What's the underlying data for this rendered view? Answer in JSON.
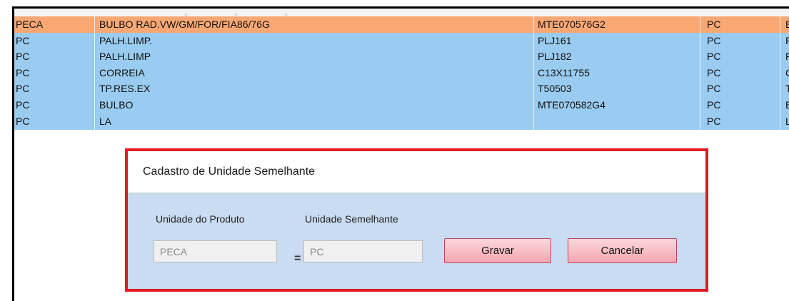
{
  "table": {
    "rows": [
      {
        "unit": "PECA",
        "description": "BULBO RAD.VW/GM/FOR/FIA86/76G",
        "code": "MTE070576G2",
        "similar": "PC",
        "next": "B",
        "selected": true
      },
      {
        "unit": "PC",
        "description": "PALH.LIMP.",
        "code": "PLJ161",
        "similar": "PC",
        "next": "F",
        "selected": false
      },
      {
        "unit": "PC",
        "description": "PALH.LIMP",
        "code": "PLJ182",
        "similar": "PC",
        "next": "F",
        "selected": false
      },
      {
        "unit": "PC",
        "description": "CORREIA",
        "code": "C13X11755",
        "similar": "PC",
        "next": "C",
        "selected": false
      },
      {
        "unit": "PC",
        "description": "TP.RES.EX",
        "code": "T50503",
        "similar": "PC",
        "next": "T",
        "selected": false
      },
      {
        "unit": "PC",
        "description": "BULBO",
        "code": "MTE070582G4",
        "similar": "PC",
        "next": "B",
        "selected": false
      },
      {
        "unit": "PC",
        "description": "LA",
        "code": "",
        "similar": "PC",
        "next": "L",
        "selected": false
      }
    ],
    "colors": {
      "selected_row": "#f9a874",
      "normal_row": "#99ccf0"
    }
  },
  "dialog": {
    "title": "Cadastro de Unidade Semelhante",
    "product_unit_label": "Unidade do Produto",
    "product_unit_value": "PECA",
    "equals": "=",
    "similar_unit_label": "Unidade Semelhante",
    "similar_unit_value": "PC",
    "save_label": "Gravar",
    "cancel_label": "Cancelar",
    "highlight_color": "#e01b22"
  }
}
